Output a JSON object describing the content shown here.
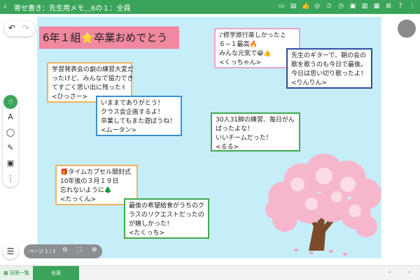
{
  "header": {
    "back_icon": "chevron-left-icon",
    "title": "寄せ書き：先生用メモ＿6の１：全員",
    "icons": [
      "monitor-icon",
      "clipboard-icon",
      "thumbs-up-icon",
      "chat-icon",
      "timer-icon",
      "clock-icon",
      "image-icon",
      "chart-icon",
      "layout-icon",
      "grid-icon",
      "help-icon",
      "more-icon"
    ]
  },
  "title_card": {
    "text": "6年１組⭐卒業おめでとう",
    "color": "#f0889f"
  },
  "cards": [
    {
      "text": "学習発表会の劇の練習大変だ\nったけど、みんなで協力でき\nてすごく思い出に残った✌\n<ひっさー>"
    },
    {
      "text": "いままでありがとう！\nクラス会企画するよ！\n卒業してもまた遊ぼうね！\n<ムータン>"
    },
    {
      "text": "♪修学旅行楽しかった♫\n６−１最高🔥\nみんな元気で😁👍\n<くっちゃん>"
    },
    {
      "text": "先生のギターで、朝の会の\n歌を歌うのも今日で最後。\n今日は思い切り歌ったよ！\n<りんりん>"
    },
    {
      "text": "30人31脚の練習、毎日がん\nばったよな！\nいいチームだった！\n<るる>"
    },
    {
      "text": "🎁タイムカプセル開封式\n10年後の３月１９日\n忘れないように🌲\n<たっくん>"
    },
    {
      "text": "最後の希望給食がうちのク\nラスのリクエストだったの\nが嬉しかった！\n<たくっち>"
    }
  ],
  "toolbar": {
    "undo_icon": "undo-icon",
    "redo_icon": "redo-icon",
    "tools": [
      {
        "icon": "pointer-hand-icon",
        "glyph": "☝"
      },
      {
        "icon": "text-tool-icon",
        "glyph": "A"
      },
      {
        "icon": "shape-tool-icon",
        "glyph": "◯"
      },
      {
        "icon": "pen-tool-icon",
        "glyph": "✎"
      },
      {
        "icon": "image-tool-icon",
        "glyph": "▣"
      },
      {
        "icon": "more-tools-icon",
        "glyph": "⋮"
      }
    ]
  },
  "page_bar": {
    "label": "ページ 1 / 1"
  },
  "footer": {
    "list_tab": "回答一覧",
    "all_tab": "全員"
  },
  "colors": {
    "accent": "#3aa55a",
    "canvas": "#c6eef9"
  }
}
